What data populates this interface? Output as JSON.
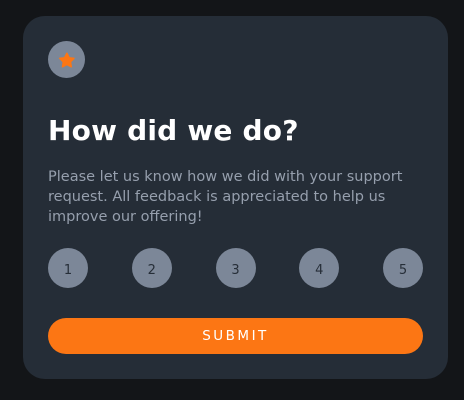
{
  "card": {
    "icon": "star-icon",
    "title": "How did we do?",
    "description": "Please let us know how we did with your support request. All feedback is appreciated to help us improve our offering!",
    "ratings": [
      "1",
      "2",
      "3",
      "4",
      "5"
    ],
    "submit_label": "SUBMIT"
  },
  "colors": {
    "background": "#131518",
    "card": "#252d37",
    "accent": "#fc7614",
    "rating_circle": "#7c8798",
    "text_muted": "#969fad"
  }
}
